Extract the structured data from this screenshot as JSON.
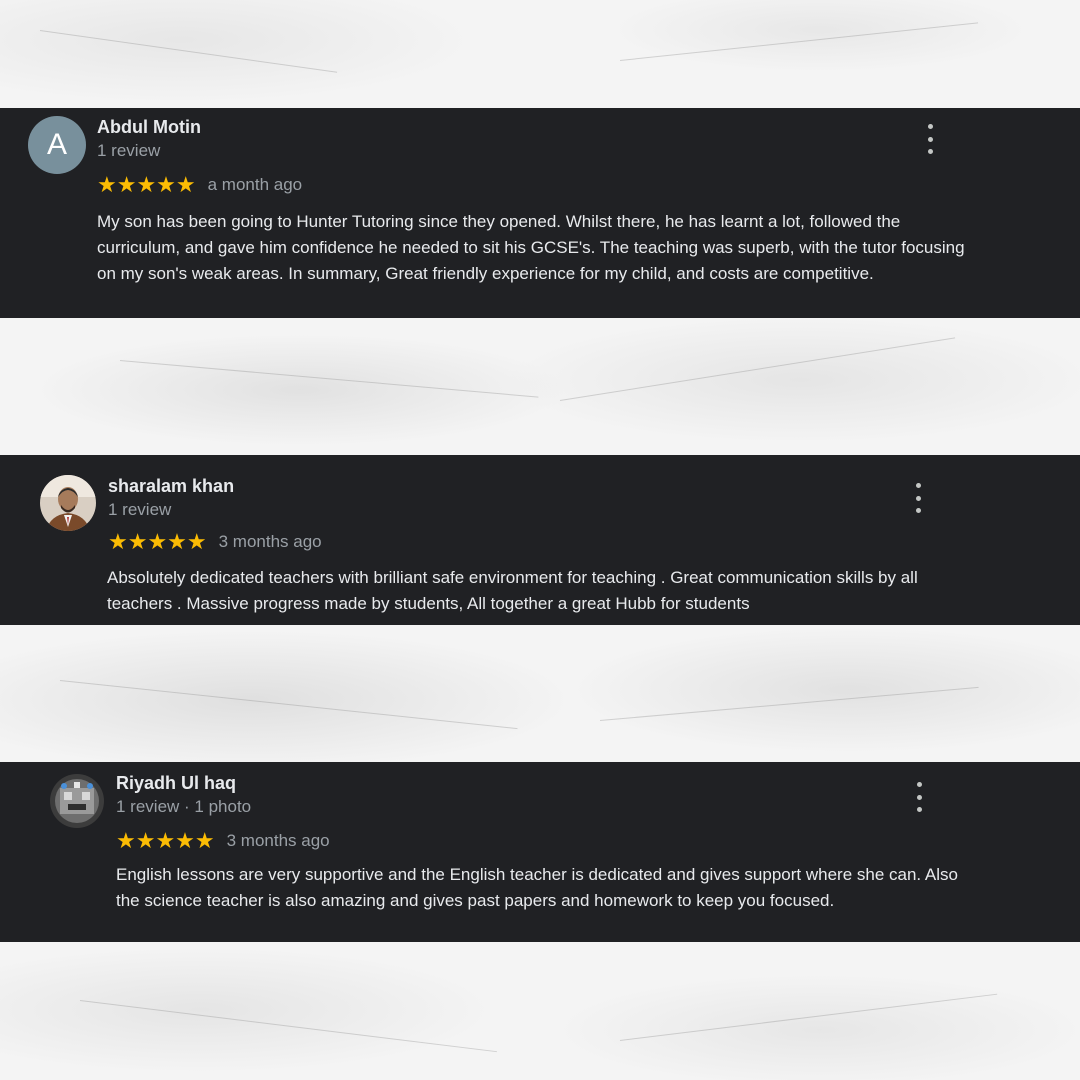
{
  "reviews": [
    {
      "reviewer_name": "Abdul Motin",
      "avatar_letter": "A",
      "meta": "1 review",
      "stars": "★★★★★",
      "rating": 5,
      "time": "a month ago",
      "text": "My son has been going to Hunter Tutoring since they opened. Whilst there, he has learnt a lot, followed the curriculum, and gave him confidence he needed to sit his GCSE's.  The teaching was superb, with the tutor focusing on my son's weak areas.  In summary, Great friendly experience for my child, and costs are competitive."
    },
    {
      "reviewer_name": "sharalam khan",
      "meta": "1 review",
      "stars": "★★★★★",
      "rating": 5,
      "time": "3 months ago",
      "text": "Absolutely dedicated teachers with brilliant safe environment for teaching . Great communication skills by all teachers . Massive progress made by students, All together a great Hubb for students"
    },
    {
      "reviewer_name": "Riyadh Ul haq",
      "meta": "1 review · 1 photo",
      "stars": "★★★★★",
      "rating": 5,
      "time": "3 months ago",
      "text": "English lessons are very supportive and the English teacher is dedicated and gives support where she can. Also the science teacher is also amazing and gives past papers and homework to keep you focused."
    }
  ],
  "icons": {
    "more_options": "more-vertical-icon",
    "star": "star-icon"
  },
  "colors": {
    "card_background": "#202124",
    "star": "#fbbc04",
    "avatar_letter_bg": "#78909c"
  }
}
